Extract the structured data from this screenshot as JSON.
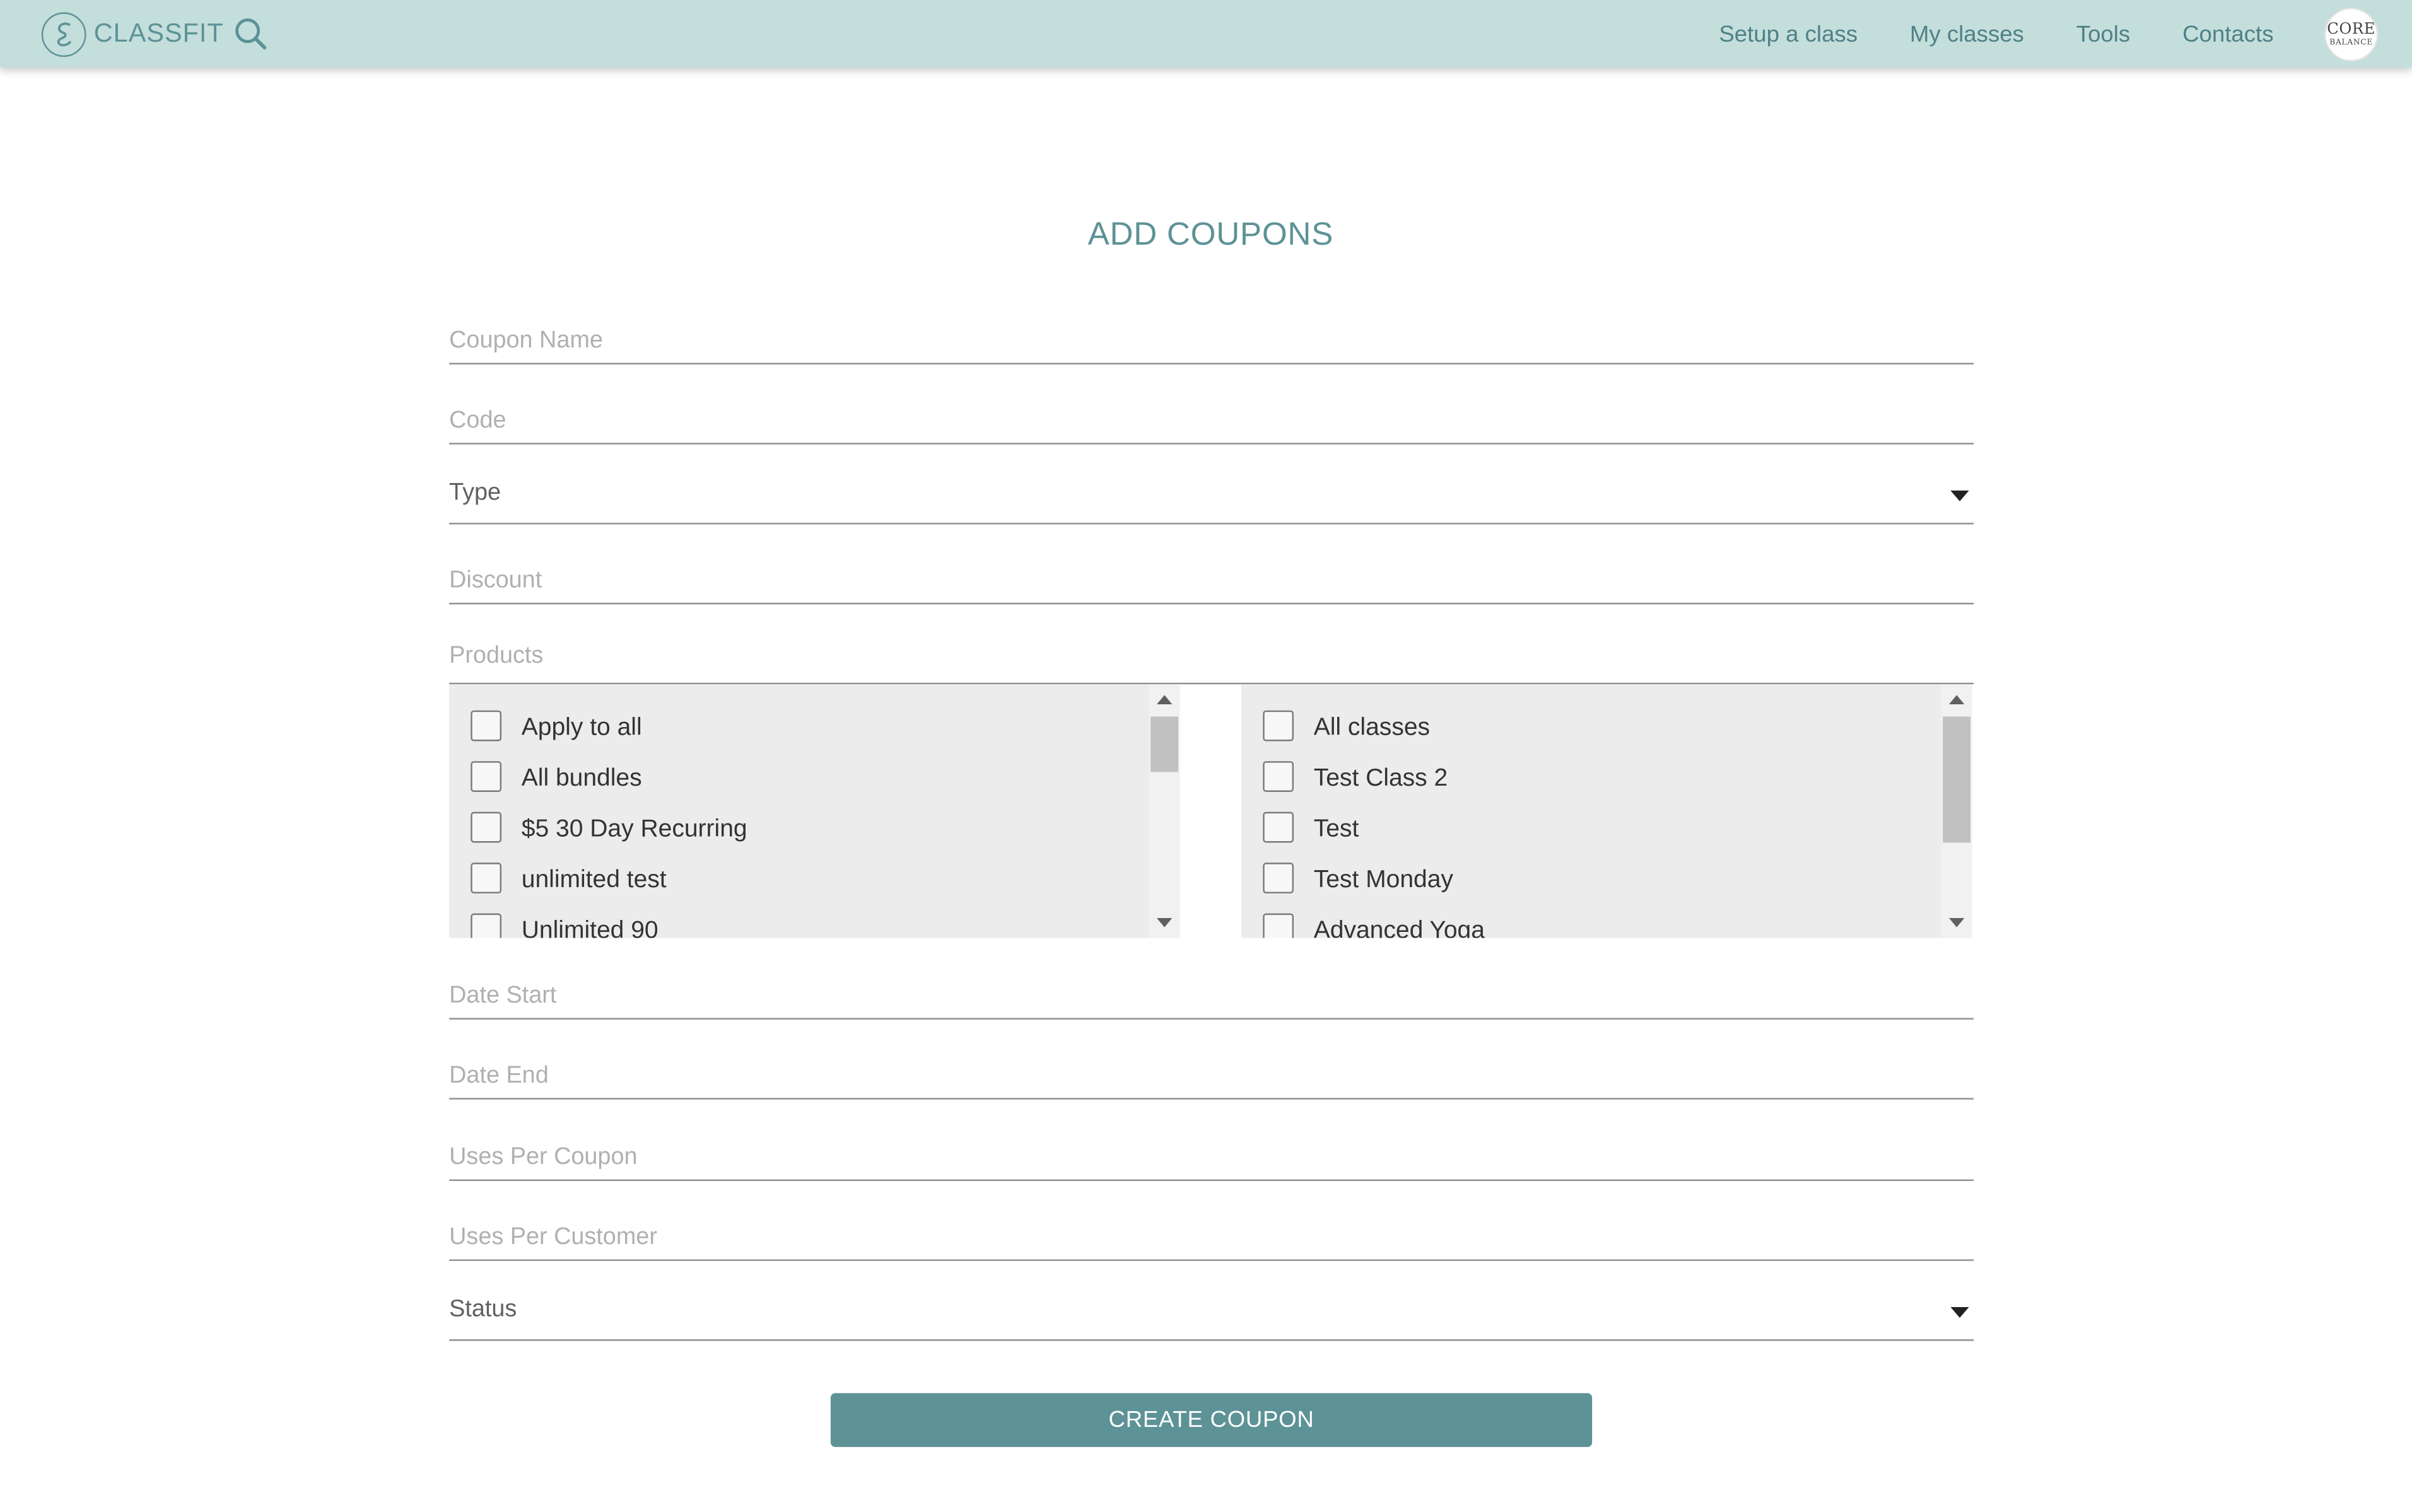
{
  "brand": {
    "name": "CLASSFIT",
    "color": "#5d9296"
  },
  "nav": {
    "links": [
      "Setup a class",
      "My classes",
      "Tools",
      "Contacts"
    ],
    "avatar_line1": "CORE",
    "avatar_line2": "BALANCE",
    "background": "#c4dedc"
  },
  "page": {
    "title": "ADD COUPONS"
  },
  "form": {
    "coupon_name_placeholder": "Coupon Name",
    "code_placeholder": "Code",
    "type_label": "Type",
    "discount_placeholder": "Discount",
    "products_label": "Products",
    "bundles": [
      "Apply to all",
      "All bundles",
      "$5 30 Day Recurring",
      "unlimited test",
      "Unlimited 90"
    ],
    "classes": [
      "All classes",
      "Test Class 2",
      "Test",
      "Test Monday",
      "Advanced Yoga"
    ],
    "date_start_placeholder": "Date Start",
    "date_end_placeholder": "Date End",
    "uses_per_coupon_placeholder": "Uses Per Coupon",
    "uses_per_customer_placeholder": "Uses Per Customer",
    "status_label": "Status",
    "submit_label": "CREATE COUPON"
  }
}
